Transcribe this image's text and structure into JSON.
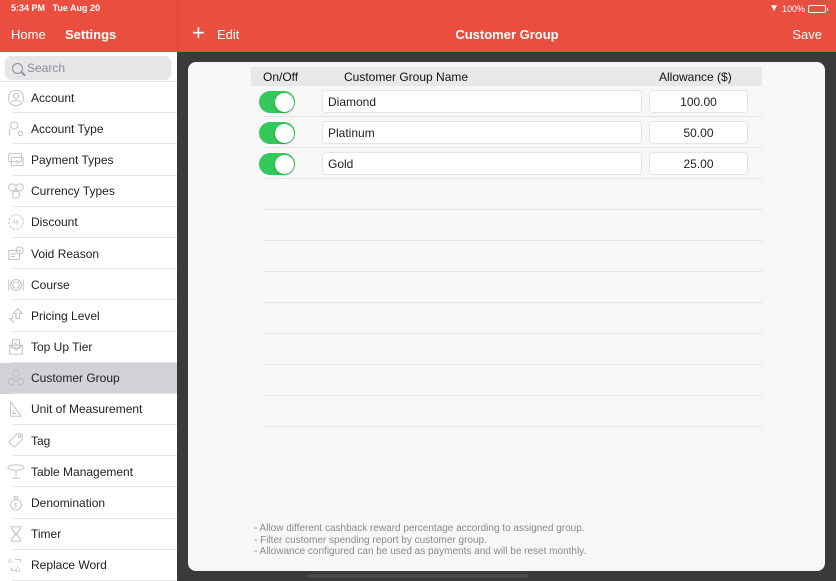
{
  "status": {
    "time": "5:34 PM",
    "date": "Tue Aug 20",
    "battery": "100%"
  },
  "nav": {
    "home": "Home",
    "settings": "Settings",
    "edit": "Edit",
    "title": "Customer Group",
    "save": "Save",
    "plus": "+"
  },
  "search": {
    "placeholder": "Search"
  },
  "sidebar": {
    "items": [
      {
        "label": "Account",
        "icon": "account-icon"
      },
      {
        "label": "Account Type",
        "icon": "account-type-icon"
      },
      {
        "label": "Payment Types",
        "icon": "payment-types-icon"
      },
      {
        "label": "Currency Types",
        "icon": "currency-types-icon"
      },
      {
        "label": "Discount",
        "icon": "discount-icon"
      },
      {
        "label": "Void Reason",
        "icon": "void-reason-icon"
      },
      {
        "label": "Course",
        "icon": "course-icon"
      },
      {
        "label": "Pricing Level",
        "icon": "pricing-level-icon"
      },
      {
        "label": "Top Up Tier",
        "icon": "top-up-tier-icon"
      },
      {
        "label": "Customer Group",
        "icon": "customer-group-icon",
        "active": true
      },
      {
        "label": "Unit of Measurement",
        "icon": "unit-of-measurement-icon"
      },
      {
        "label": "Tag",
        "icon": "tag-icon"
      },
      {
        "label": "Table Management",
        "icon": "table-management-icon"
      },
      {
        "label": "Denomination",
        "icon": "denomination-icon"
      },
      {
        "label": "Timer",
        "icon": "timer-icon"
      },
      {
        "label": "Replace Word",
        "icon": "replace-word-icon"
      }
    ]
  },
  "table": {
    "headers": {
      "onoff": "On/Off",
      "name": "Customer Group Name",
      "allowance": "Allowance ($)"
    },
    "rows": [
      {
        "enabled": true,
        "name": "Diamond",
        "allowance": "100.00"
      },
      {
        "enabled": true,
        "name": "Platinum",
        "allowance": "50.00"
      },
      {
        "enabled": true,
        "name": "Gold",
        "allowance": "25.00"
      }
    ]
  },
  "notes": [
    "- Allow different cashback reward percentage according to assigned group.",
    "- Filter customer spending report by customer group.",
    "- Allowance configured can be used as payments and will be reset monthly."
  ],
  "colors": {
    "accent": "#e94e3f",
    "toggle_on": "#34c759",
    "selected": "#d1d1d6"
  }
}
